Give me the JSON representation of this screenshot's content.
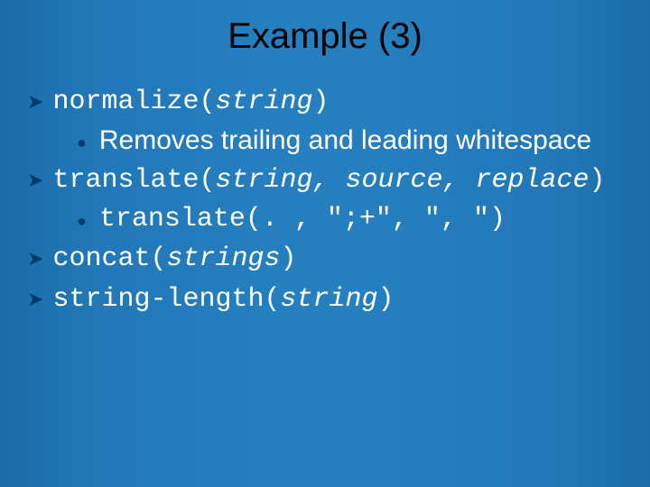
{
  "title": "Example (3)",
  "items": {
    "normalize": {
      "fn": "normalize(",
      "arg": "string",
      "close": ")"
    },
    "normalize_desc": "Removes trailing and leading whitespace",
    "translate": {
      "fn": "translate(",
      "arg": "string, source, replace",
      "close": ")"
    },
    "translate_ex": "translate(. , \";+\", \", \")",
    "concat": {
      "fn": "concat(",
      "arg": "strings",
      "close": ")"
    },
    "strlen": {
      "fn": "string-length(",
      "arg": "string",
      "close": ")"
    }
  }
}
